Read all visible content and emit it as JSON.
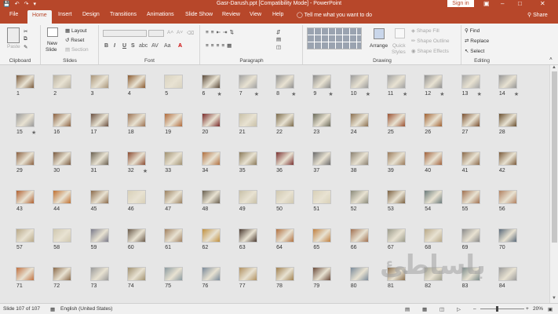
{
  "window": {
    "title": "Gasr-Darush.ppt [Compatibility Mode] - PowerPoint",
    "sign_in": "Sign in",
    "share": "Share",
    "tell_me": "Tell me what you want to do"
  },
  "tabs": [
    "File",
    "Home",
    "Insert",
    "Design",
    "Transitions",
    "Animations",
    "Slide Show",
    "Review",
    "View",
    "Help"
  ],
  "ribbon": {
    "clipboard": {
      "label": "Clipboard",
      "paste": "Paste"
    },
    "slides": {
      "label": "Slides",
      "new_slide_line1": "New",
      "new_slide_line2": "Slide",
      "layout": "Layout",
      "reset": "Reset",
      "section": "Section"
    },
    "font": {
      "label": "Font",
      "bold": "B",
      "italic": "I",
      "underline": "U",
      "strike": "S",
      "shadow": "abc",
      "spacing": "AV",
      "case": "Aa"
    },
    "paragraph": {
      "label": "Paragraph"
    },
    "drawing": {
      "label": "Drawing",
      "arrange": "Arrange",
      "quick_styles_line1": "Quick",
      "quick_styles_line2": "Styles",
      "shape_fill": "Shape Fill",
      "shape_outline": "Shape Outline",
      "shape_effects": "Shape Effects"
    },
    "editing": {
      "label": "Editing",
      "find": "Find",
      "replace": "Replace",
      "select": "Select"
    }
  },
  "slides": [
    {
      "n": "1",
      "star": false,
      "c": "#7a5a3c"
    },
    {
      "n": "2",
      "star": false,
      "c": "#b8b0a0"
    },
    {
      "n": "3",
      "star": false,
      "c": "#a89478"
    },
    {
      "n": "4",
      "star": false,
      "c": "#8a5a30"
    },
    {
      "n": "5",
      "star": false,
      "c": "#d8d2c0"
    },
    {
      "n": "6",
      "star": true,
      "c": "#5a4a3a"
    },
    {
      "n": "7",
      "star": true,
      "c": "#a0a0a0"
    },
    {
      "n": "8",
      "star": true,
      "c": "#909090"
    },
    {
      "n": "9",
      "star": true,
      "c": "#8a8a8a"
    },
    {
      "n": "10",
      "star": true,
      "c": "#9a9a9a"
    },
    {
      "n": "11",
      "star": true,
      "c": "#a0a0a0"
    },
    {
      "n": "12",
      "star": true,
      "c": "#8f8f8f"
    },
    {
      "n": "13",
      "star": true,
      "c": "#a5a5a5"
    },
    {
      "n": "14",
      "star": true,
      "c": "#959595"
    },
    {
      "n": "15",
      "star": true,
      "c": "#989898"
    },
    {
      "n": "16",
      "star": false,
      "c": "#8a6040"
    },
    {
      "n": "17",
      "star": false,
      "c": "#6a5040"
    },
    {
      "n": "18",
      "star": false,
      "c": "#9a7050"
    },
    {
      "n": "19",
      "star": false,
      "c": "#b06a3a"
    },
    {
      "n": "20",
      "star": false,
      "c": "#7a2a2a"
    },
    {
      "n": "21",
      "star": false,
      "c": "#c8c0a8"
    },
    {
      "n": "22",
      "star": false,
      "c": "#7a6a4a"
    },
    {
      "n": "23",
      "star": false,
      "c": "#6a6a5a"
    },
    {
      "n": "24",
      "star": false,
      "c": "#8a7050"
    },
    {
      "n": "25",
      "star": false,
      "c": "#9a5030"
    },
    {
      "n": "26",
      "star": false,
      "c": "#a06030"
    },
    {
      "n": "27",
      "star": false,
      "c": "#7a5030"
    },
    {
      "n": "28",
      "star": false,
      "c": "#6a5030"
    },
    {
      "n": "29",
      "star": false,
      "c": "#8a6040"
    },
    {
      "n": "30",
      "star": false,
      "c": "#7a5a40"
    },
    {
      "n": "31",
      "star": false,
      "c": "#6a6050"
    },
    {
      "n": "32",
      "star": true,
      "c": "#8a4a30"
    },
    {
      "n": "33",
      "star": false,
      "c": "#a09070"
    },
    {
      "n": "34",
      "star": false,
      "c": "#b07040"
    },
    {
      "n": "35",
      "star": false,
      "c": "#8a7a5a"
    },
    {
      "n": "36",
      "star": false,
      "c": "#7a3030"
    },
    {
      "n": "37",
      "star": false,
      "c": "#6a6a6a"
    },
    {
      "n": "38",
      "star": false,
      "c": "#8a8070"
    },
    {
      "n": "39",
      "star": false,
      "c": "#9a7a5a"
    },
    {
      "n": "40",
      "star": false,
      "c": "#a0603a"
    },
    {
      "n": "41",
      "star": false,
      "c": "#8a6a4a"
    },
    {
      "n": "42",
      "star": false,
      "c": "#7a5a3a"
    },
    {
      "n": "43",
      "star": false,
      "c": "#b06030"
    },
    {
      "n": "44",
      "star": false,
      "c": "#c07030"
    },
    {
      "n": "45",
      "star": false,
      "c": "#8a6a4a"
    },
    {
      "n": "46",
      "star": false,
      "c": "#d8d0b8"
    },
    {
      "n": "47",
      "star": false,
      "c": "#9a8060"
    },
    {
      "n": "48",
      "star": false,
      "c": "#6a6050"
    },
    {
      "n": "49",
      "star": false,
      "c": "#c8c0a8"
    },
    {
      "n": "50",
      "star": false,
      "c": "#d0c8b0"
    },
    {
      "n": "51",
      "star": false,
      "c": "#d8d0b8"
    },
    {
      "n": "52",
      "star": false,
      "c": "#8a8a7a"
    },
    {
      "n": "53",
      "star": false,
      "c": "#7a6040"
    },
    {
      "n": "54",
      "star": false,
      "c": "#6a7a7a"
    },
    {
      "n": "55",
      "star": false,
      "c": "#a07050"
    },
    {
      "n": "56",
      "star": false,
      "c": "#b08060"
    },
    {
      "n": "57",
      "star": false,
      "c": "#b8a888"
    },
    {
      "n": "58",
      "star": false,
      "c": "#d0c8b0"
    },
    {
      "n": "59",
      "star": false,
      "c": "#7a7a8a"
    },
    {
      "n": "60",
      "star": false,
      "c": "#6a5a4a"
    },
    {
      "n": "61",
      "star": false,
      "c": "#a08060"
    },
    {
      "n": "62",
      "star": false,
      "c": "#c09040"
    },
    {
      "n": "63",
      "star": false,
      "c": "#4a3a30"
    },
    {
      "n": "64",
      "star": false,
      "c": "#b07040"
    },
    {
      "n": "65",
      "star": false,
      "c": "#c08040"
    },
    {
      "n": "66",
      "star": false,
      "c": "#a07050"
    },
    {
      "n": "67",
      "star": false,
      "c": "#9a9a8a"
    },
    {
      "n": "68",
      "star": false,
      "c": "#b8a888"
    },
    {
      "n": "69",
      "star": false,
      "c": "#8a8a8a"
    },
    {
      "n": "70",
      "star": false,
      "c": "#5a6a7a"
    },
    {
      "n": "71",
      "star": false,
      "c": "#c07040"
    },
    {
      "n": "72",
      "star": false,
      "c": "#8a6a4a"
    },
    {
      "n": "73",
      "star": false,
      "c": "#9a9a9a"
    },
    {
      "n": "74",
      "star": false,
      "c": "#a09070"
    },
    {
      "n": "75",
      "star": false,
      "c": "#8a9aa0"
    },
    {
      "n": "76",
      "star": false,
      "c": "#7a8a9a"
    },
    {
      "n": "77",
      "star": false,
      "c": "#b09060"
    },
    {
      "n": "78",
      "star": false,
      "c": "#a08050"
    },
    {
      "n": "79",
      "star": false,
      "c": "#6a4a3a"
    },
    {
      "n": "80",
      "star": false,
      "c": "#7a8a9a"
    },
    {
      "n": "81",
      "star": false,
      "c": "#8a7050"
    },
    {
      "n": "82",
      "star": false,
      "c": "#a0a090"
    },
    {
      "n": "83",
      "star": false,
      "c": "#7a8a8a"
    },
    {
      "n": "84",
      "star": false,
      "c": "#9a9a9a"
    }
  ],
  "watermark": "باساطئ",
  "status": {
    "slide_of": "Slide 107 of 107",
    "language": "English (United States)",
    "zoom": "20%"
  },
  "colors": {
    "accent": "#b7472a",
    "ribbon": "#f3f3f3",
    "canvas": "#e6e6e6"
  },
  "icons": [
    "save-icon",
    "undo-icon",
    "redo-icon",
    "lightbulb-icon",
    "person-icon",
    "star-icon",
    "search-icon",
    "minimize-icon",
    "maximize-icon",
    "close-icon"
  ]
}
